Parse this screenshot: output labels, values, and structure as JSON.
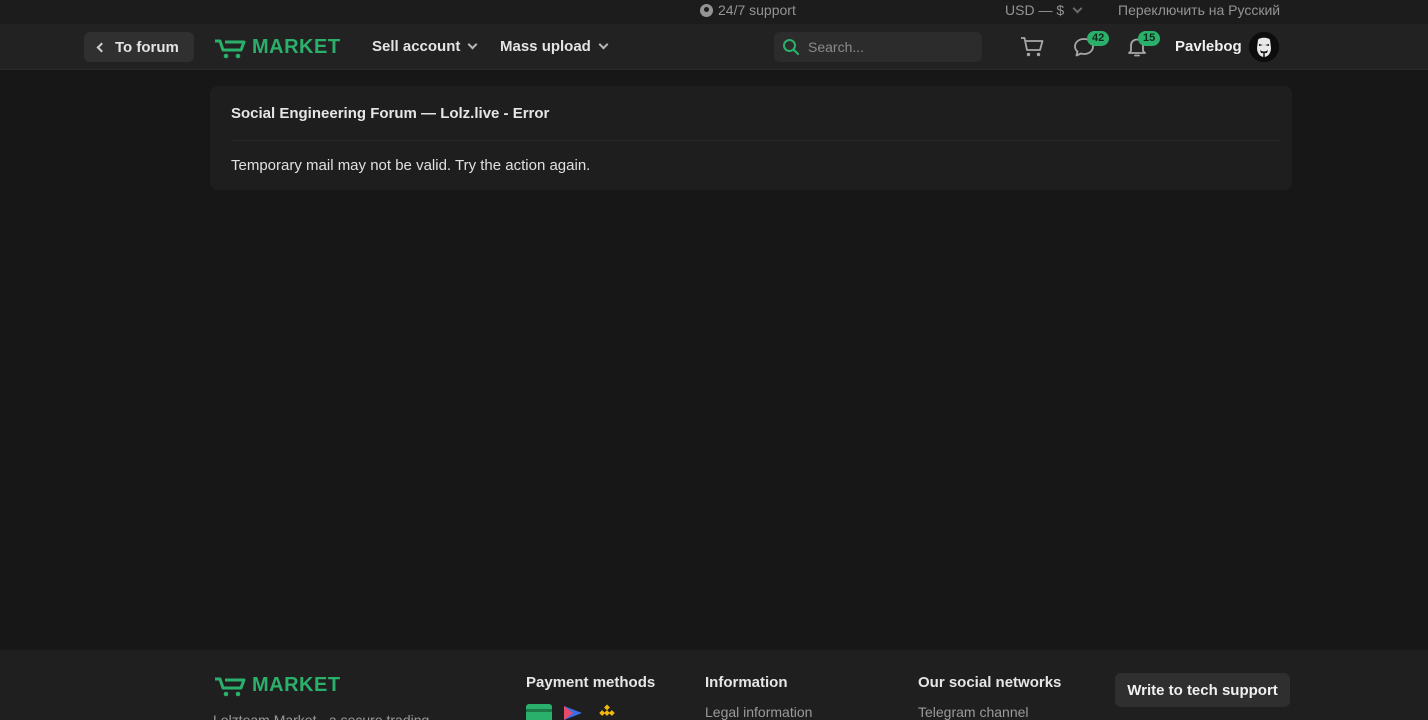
{
  "topbar": {
    "support_label": "24/7 support",
    "currency_label": "USD — $",
    "language_switch": "Переключить на Русский"
  },
  "header": {
    "back_button": "To forum",
    "logo_text": "MARKET",
    "nav": [
      {
        "label": "Sell account"
      },
      {
        "label": "Mass upload"
      }
    ],
    "search_placeholder": "Search...",
    "messages_count": "42",
    "notifications_count": "15",
    "username": "Pavlebog"
  },
  "main": {
    "title": "Social Engineering Forum — Lolz.live - Error",
    "message": "Temporary mail may not be valid. Try the action again."
  },
  "footer": {
    "logo_text": "MARKET",
    "tagline": "Lolzteam Market - a secure trading",
    "payment_title": "Payment methods",
    "info_title": "Information",
    "info_link": "Legal information",
    "social_title": "Our social networks",
    "social_link": "Telegram channel",
    "tech_support_button": "Write to tech support"
  },
  "colors": {
    "accent": "#2bb06b",
    "background": "#171717",
    "header": "#222222"
  }
}
